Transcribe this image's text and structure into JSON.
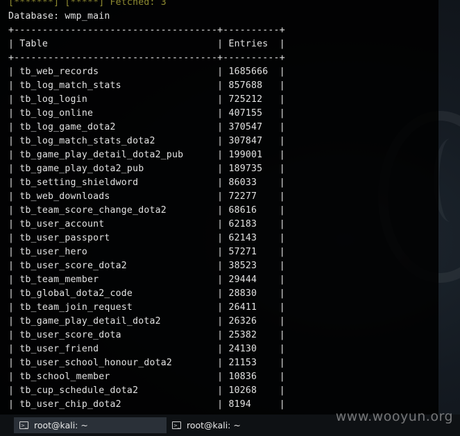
{
  "terminal": {
    "prompt_fragment": "[*******] [*****] Fetched: 3",
    "database_line": "Database: wmp_main",
    "separator": "+------------------------------------+----------+",
    "header": {
      "table": "Table",
      "entries": "Entries"
    },
    "rows": [
      {
        "table": "tb_web_records",
        "entries": "1685666"
      },
      {
        "table": "tb_log_match_stats",
        "entries": "857688"
      },
      {
        "table": "tb_log_login",
        "entries": "725212"
      },
      {
        "table": "tb_log_online",
        "entries": "407155"
      },
      {
        "table": "tb_log_game_dota2",
        "entries": "370547"
      },
      {
        "table": "tb_log_match_stats_dota2",
        "entries": "307847"
      },
      {
        "table": "tb_game_play_detail_dota2_pub",
        "entries": "199001"
      },
      {
        "table": "tb_game_play_dota2_pub",
        "entries": "189735"
      },
      {
        "table": "tb_setting_shieldword",
        "entries": "86033"
      },
      {
        "table": "tb_web_downloads",
        "entries": "72277"
      },
      {
        "table": "tb_team_score_change_dota2",
        "entries": "68616"
      },
      {
        "table": "tb_user_account",
        "entries": "62183"
      },
      {
        "table": "tb_user_passport",
        "entries": "62143"
      },
      {
        "table": "tb_user_hero",
        "entries": "57271"
      },
      {
        "table": "tb_user_score_dota2",
        "entries": "38523"
      },
      {
        "table": "tb_team_member",
        "entries": "29444"
      },
      {
        "table": "tb_global_dota2_code",
        "entries": "28830"
      },
      {
        "table": "tb_team_join_request",
        "entries": "26411"
      },
      {
        "table": "tb_game_play_detail_dota2",
        "entries": "26326"
      },
      {
        "table": "tb_user_score_dota",
        "entries": "25382"
      },
      {
        "table": "tb_user_friend",
        "entries": "24130"
      },
      {
        "table": "tb_user_school_honour_dota2",
        "entries": "21153"
      },
      {
        "table": "tb_school_member",
        "entries": "10836"
      },
      {
        "table": "tb_cup_schedule_dota2",
        "entries": "10268"
      },
      {
        "table": "tb_user_chip_dota2",
        "entries": "8194"
      }
    ]
  },
  "taskbar": {
    "tasks": [
      {
        "label": "root@kali: ~",
        "icon": "terminal-icon",
        "active": true
      },
      {
        "label": "root@kali: ~",
        "icon": "terminal-icon",
        "active": false
      }
    ]
  },
  "watermark": "www.wooyun.org"
}
